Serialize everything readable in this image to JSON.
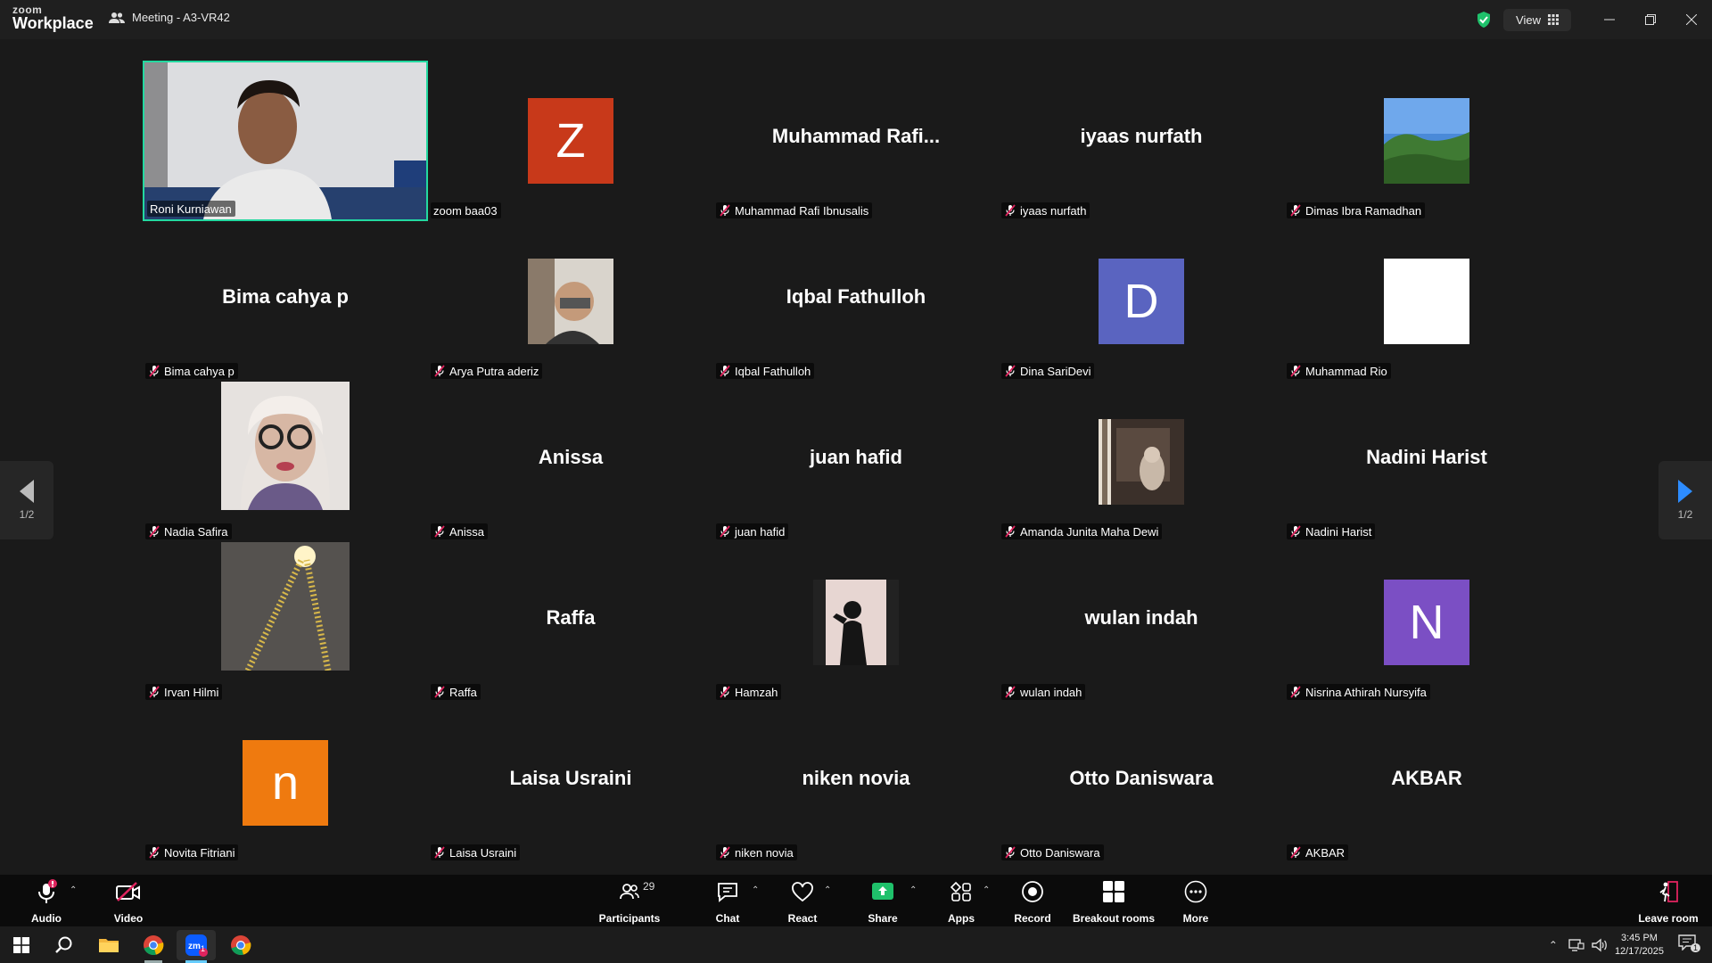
{
  "app": {
    "logo_small": "zoom",
    "logo_big": "Workplace",
    "meeting_title": "Meeting - A3-VR42"
  },
  "titlebar": {
    "view_label": "View"
  },
  "pager": {
    "left_text": "1/2",
    "right_text": "1/2"
  },
  "participants": [
    {
      "name": "Roni Kurniawan",
      "label": "Roni Kurniawan",
      "kind": "video",
      "muted": false,
      "active": true
    },
    {
      "name": "zoom baa03",
      "label": "zoom baa03",
      "kind": "avatar",
      "letter": "Z",
      "color": "#c8391a",
      "muted": false
    },
    {
      "name": "Muhammad  Rafi...",
      "label": "Muhammad Rafi Ibnusalis",
      "kind": "name",
      "muted": true
    },
    {
      "name": "iyaas nurfath",
      "label": "iyaas nurfath",
      "kind": "name",
      "muted": true
    },
    {
      "name": "Dimas Ibra Ramadhan",
      "label": "Dimas Ibra Ramadhan",
      "kind": "photo",
      "photo": "landscape",
      "muted": true
    },
    {
      "name": "Bima cahya p",
      "label": "Bima cahya p",
      "kind": "name",
      "muted": true
    },
    {
      "name": "Arya Putra aderiz",
      "label": "Arya Putra aderiz",
      "kind": "photo",
      "photo": "selfie",
      "muted": true
    },
    {
      "name": "Iqbal Fathulloh",
      "label": "Iqbal Fathulloh",
      "kind": "name",
      "muted": true
    },
    {
      "name": "Dina SariDevi",
      "label": "Dina SariDevi",
      "kind": "avatar",
      "letter": "D",
      "color": "#5a64c0",
      "muted": true
    },
    {
      "name": "Muhammad Rio",
      "label": "Muhammad Rio",
      "kind": "avatar",
      "letter": "",
      "color": "#ffffff",
      "muted": true
    },
    {
      "name": "Nadia Safira",
      "label": "Nadia Safira",
      "kind": "photo",
      "photo": "portrait",
      "muted": true
    },
    {
      "name": "Anissa",
      "label": "Anissa",
      "kind": "name",
      "muted": true
    },
    {
      "name": "juan hafid",
      "label": "juan hafid",
      "kind": "name",
      "muted": true
    },
    {
      "name": "Amanda Junita Maha Dewi",
      "label": "Amanda Junita Maha Dewi",
      "kind": "photo",
      "photo": "room",
      "muted": true
    },
    {
      "name": "Nadini Harist",
      "label": "Nadini Harist",
      "kind": "name",
      "muted": true
    },
    {
      "name": "Irvan Hilmi",
      "label": "Irvan Hilmi",
      "kind": "photo",
      "photo": "lights",
      "muted": true
    },
    {
      "name": "Raffa",
      "label": "Raffa",
      "kind": "name",
      "muted": true
    },
    {
      "name": "Hamzah",
      "label": "Hamzah",
      "kind": "photo",
      "photo": "silhouette",
      "muted": true
    },
    {
      "name": "wulan indah",
      "label": "wulan indah",
      "kind": "name",
      "muted": true
    },
    {
      "name": "Nisrina Athirah Nursyifa",
      "label": "Nisrina Athirah Nursyifa",
      "kind": "avatar",
      "letter": "N",
      "color": "#7b4fc4",
      "muted": true
    },
    {
      "name": "Novita Fitriani",
      "label": "Novita Fitriani",
      "kind": "avatar",
      "letter": "n",
      "color": "#ef7a0f",
      "muted": true
    },
    {
      "name": "Laisa Usraini",
      "label": "Laisa Usraini",
      "kind": "name",
      "muted": true
    },
    {
      "name": "niken novia",
      "label": "niken novia",
      "kind": "name",
      "muted": true
    },
    {
      "name": "Otto Daniswara",
      "label": "Otto Daniswara",
      "kind": "name",
      "muted": true
    },
    {
      "name": "AKBAR",
      "label": "AKBAR",
      "kind": "name",
      "muted": true
    }
  ],
  "toolbar": {
    "audio": "Audio",
    "video": "Video",
    "participants": "Participants",
    "participants_count": "29",
    "chat": "Chat",
    "react": "React",
    "share": "Share",
    "apps": "Apps",
    "record": "Record",
    "breakout": "Breakout rooms",
    "more": "More",
    "leave": "Leave room"
  },
  "taskbar": {
    "time": "3:45 PM",
    "date": "12/17/2025",
    "notif_count": "1",
    "zoom_badge": "1"
  },
  "colors": {
    "accent": "#23d9a0",
    "share_green": "#1fc16b",
    "mute_red": "#e0245e",
    "blue_arrow": "#2d8cff"
  }
}
